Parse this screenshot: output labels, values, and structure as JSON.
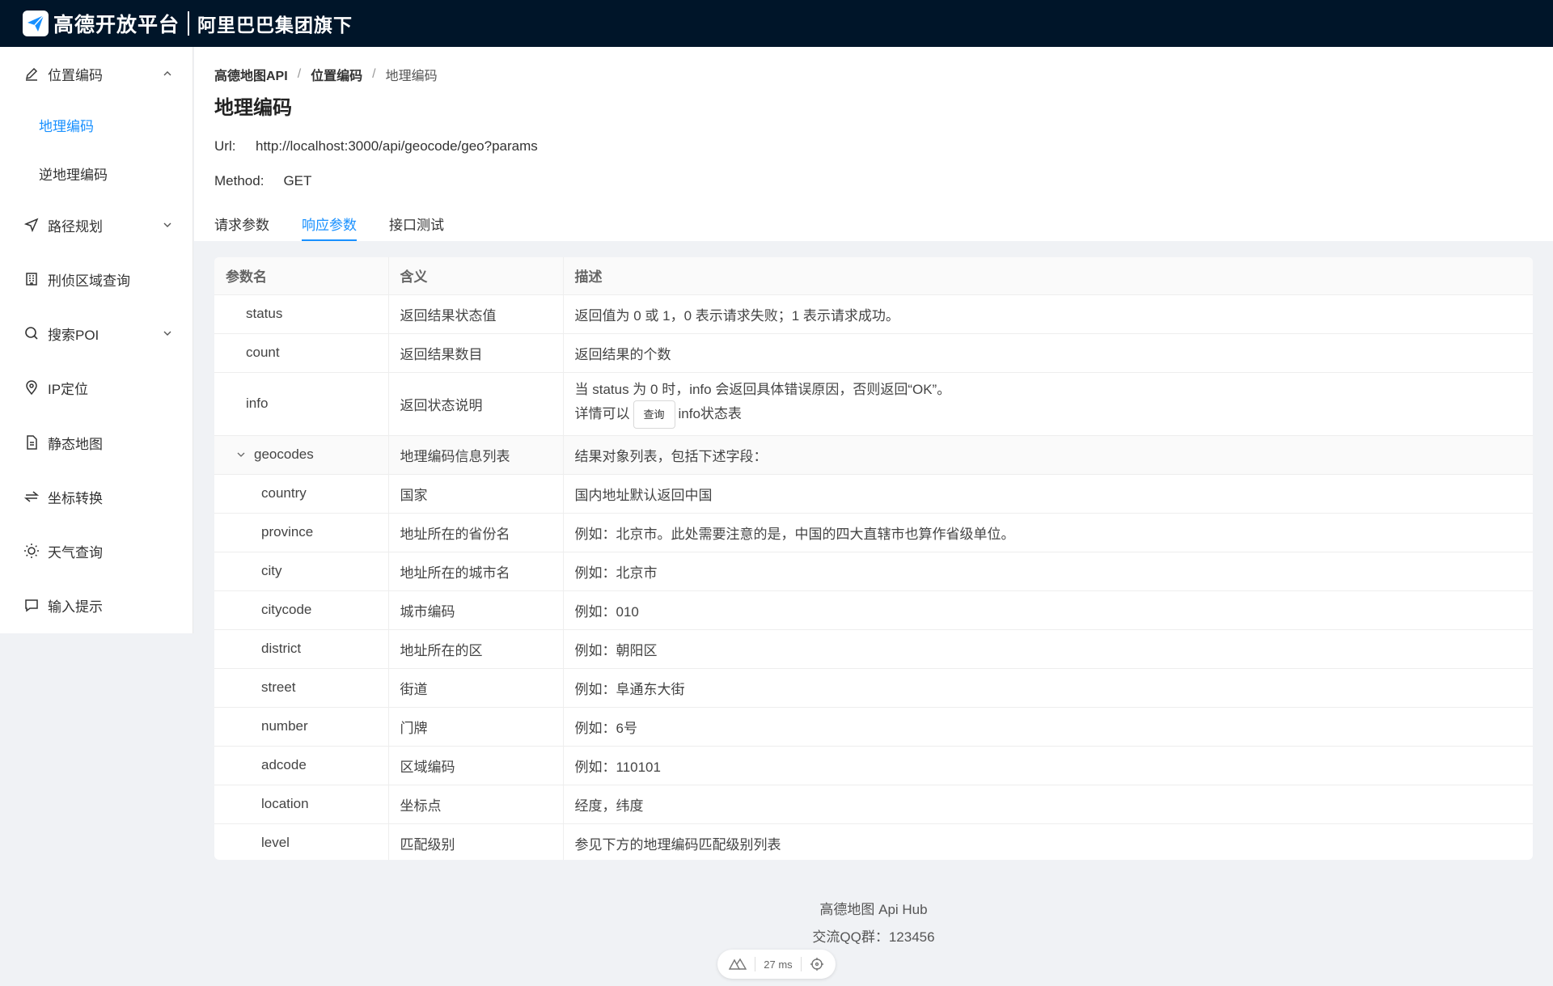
{
  "brand": {
    "name": "高德开放平台",
    "sub": "阿里巴巴集团旗下"
  },
  "sidebar": {
    "groups": [
      {
        "label": "位置编码",
        "icon": "pen-icon",
        "expanded": true,
        "children": [
          {
            "label": "地理编码",
            "active": true
          },
          {
            "label": "逆地理编码",
            "active": false
          }
        ]
      },
      {
        "label": "路径规划",
        "icon": "navigation-icon",
        "expanded": false
      },
      {
        "label": "刑侦区域查询",
        "icon": "building-icon"
      },
      {
        "label": "搜索POI",
        "icon": "search-icon",
        "expanded": false
      },
      {
        "label": "IP定位",
        "icon": "location-pin-icon"
      },
      {
        "label": "静态地图",
        "icon": "document-icon"
      },
      {
        "label": "坐标转换",
        "icon": "swap-icon"
      },
      {
        "label": "天气查询",
        "icon": "sun-icon"
      },
      {
        "label": "输入提示",
        "icon": "message-icon"
      }
    ]
  },
  "breadcrumb": [
    "高德地图API",
    "位置编码",
    "地理编码"
  ],
  "page": {
    "title": "地理编码",
    "url_label": "Url:",
    "url_value": "http://localhost:3000/api/geocode/geo?params",
    "method_label": "Method:",
    "method_value": "GET"
  },
  "tabs": [
    {
      "label": "请求参数",
      "active": false
    },
    {
      "label": "响应参数",
      "active": true
    },
    {
      "label": "接口测试",
      "active": false
    }
  ],
  "table": {
    "headers": [
      "参数名",
      "含义",
      "描述"
    ],
    "rows": [
      {
        "name": "status",
        "meaning": "返回结果状态值",
        "desc": "返回值为 0 或 1，0 表示请求失败；1 表示请求成功。"
      },
      {
        "name": "count",
        "meaning": "返回结果数目",
        "desc": "返回结果的个数"
      },
      {
        "name": "info",
        "meaning": "返回状态说明",
        "desc_line1": "当 status 为 0 时，info 会返回具体错误原因，否则返回“OK”。",
        "desc_prefix": "详情可以",
        "desc_button": "查询",
        "desc_suffix": "info状态表"
      },
      {
        "name": "geocodes",
        "meaning": "地理编码信息列表",
        "desc": "结果对象列表，包括下述字段："
      },
      {
        "name": "country",
        "meaning": "国家",
        "desc": "国内地址默认返回中国"
      },
      {
        "name": "province",
        "meaning": "地址所在的省份名",
        "desc": "例如：北京市。此处需要注意的是，中国的四大直辖市也算作省级单位。"
      },
      {
        "name": "city",
        "meaning": "地址所在的城市名",
        "desc": "例如：北京市"
      },
      {
        "name": "citycode",
        "meaning": "城市编码",
        "desc": "例如：010"
      },
      {
        "name": "district",
        "meaning": "地址所在的区",
        "desc": "例如：朝阳区"
      },
      {
        "name": "street",
        "meaning": "街道",
        "desc": "例如：阜通东大街"
      },
      {
        "name": "number",
        "meaning": "门牌",
        "desc": "例如：6号"
      },
      {
        "name": "adcode",
        "meaning": "区域编码",
        "desc": "例如：110101"
      },
      {
        "name": "location",
        "meaning": "坐标点",
        "desc": "经度，纬度"
      },
      {
        "name": "level",
        "meaning": "匹配级别",
        "desc": "参见下方的地理编码匹配级别列表"
      }
    ]
  },
  "footer": {
    "line1": "高德地图 Api Hub",
    "line2": "交流QQ群：123456"
  },
  "devtools": {
    "timing": "27 ms"
  },
  "colors": {
    "topbar": "#001529",
    "accent": "#1890ff",
    "background": "#f0f2f5"
  }
}
